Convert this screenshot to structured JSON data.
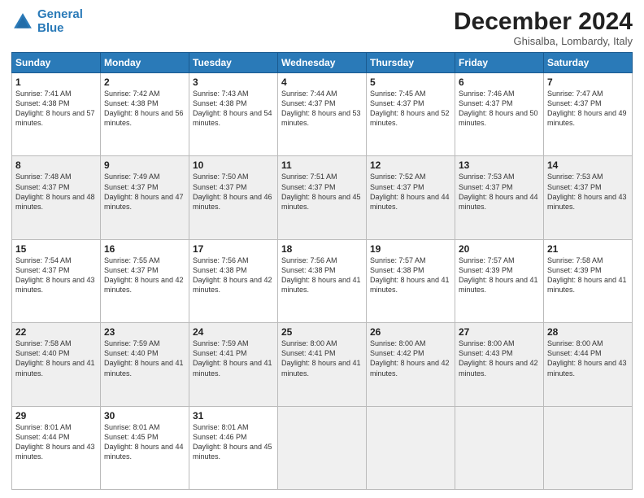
{
  "header": {
    "logo_line1": "General",
    "logo_line2": "Blue",
    "month_title": "December 2024",
    "subtitle": "Ghisalba, Lombardy, Italy"
  },
  "weekdays": [
    "Sunday",
    "Monday",
    "Tuesday",
    "Wednesday",
    "Thursday",
    "Friday",
    "Saturday"
  ],
  "weeks": [
    [
      {
        "day": "1",
        "sunrise": "Sunrise: 7:41 AM",
        "sunset": "Sunset: 4:38 PM",
        "daylight": "Daylight: 8 hours and 57 minutes."
      },
      {
        "day": "2",
        "sunrise": "Sunrise: 7:42 AM",
        "sunset": "Sunset: 4:38 PM",
        "daylight": "Daylight: 8 hours and 56 minutes."
      },
      {
        "day": "3",
        "sunrise": "Sunrise: 7:43 AM",
        "sunset": "Sunset: 4:38 PM",
        "daylight": "Daylight: 8 hours and 54 minutes."
      },
      {
        "day": "4",
        "sunrise": "Sunrise: 7:44 AM",
        "sunset": "Sunset: 4:37 PM",
        "daylight": "Daylight: 8 hours and 53 minutes."
      },
      {
        "day": "5",
        "sunrise": "Sunrise: 7:45 AM",
        "sunset": "Sunset: 4:37 PM",
        "daylight": "Daylight: 8 hours and 52 minutes."
      },
      {
        "day": "6",
        "sunrise": "Sunrise: 7:46 AM",
        "sunset": "Sunset: 4:37 PM",
        "daylight": "Daylight: 8 hours and 50 minutes."
      },
      {
        "day": "7",
        "sunrise": "Sunrise: 7:47 AM",
        "sunset": "Sunset: 4:37 PM",
        "daylight": "Daylight: 8 hours and 49 minutes."
      }
    ],
    [
      {
        "day": "8",
        "sunrise": "Sunrise: 7:48 AM",
        "sunset": "Sunset: 4:37 PM",
        "daylight": "Daylight: 8 hours and 48 minutes."
      },
      {
        "day": "9",
        "sunrise": "Sunrise: 7:49 AM",
        "sunset": "Sunset: 4:37 PM",
        "daylight": "Daylight: 8 hours and 47 minutes."
      },
      {
        "day": "10",
        "sunrise": "Sunrise: 7:50 AM",
        "sunset": "Sunset: 4:37 PM",
        "daylight": "Daylight: 8 hours and 46 minutes."
      },
      {
        "day": "11",
        "sunrise": "Sunrise: 7:51 AM",
        "sunset": "Sunset: 4:37 PM",
        "daylight": "Daylight: 8 hours and 45 minutes."
      },
      {
        "day": "12",
        "sunrise": "Sunrise: 7:52 AM",
        "sunset": "Sunset: 4:37 PM",
        "daylight": "Daylight: 8 hours and 44 minutes."
      },
      {
        "day": "13",
        "sunrise": "Sunrise: 7:53 AM",
        "sunset": "Sunset: 4:37 PM",
        "daylight": "Daylight: 8 hours and 44 minutes."
      },
      {
        "day": "14",
        "sunrise": "Sunrise: 7:53 AM",
        "sunset": "Sunset: 4:37 PM",
        "daylight": "Daylight: 8 hours and 43 minutes."
      }
    ],
    [
      {
        "day": "15",
        "sunrise": "Sunrise: 7:54 AM",
        "sunset": "Sunset: 4:37 PM",
        "daylight": "Daylight: 8 hours and 43 minutes."
      },
      {
        "day": "16",
        "sunrise": "Sunrise: 7:55 AM",
        "sunset": "Sunset: 4:37 PM",
        "daylight": "Daylight: 8 hours and 42 minutes."
      },
      {
        "day": "17",
        "sunrise": "Sunrise: 7:56 AM",
        "sunset": "Sunset: 4:38 PM",
        "daylight": "Daylight: 8 hours and 42 minutes."
      },
      {
        "day": "18",
        "sunrise": "Sunrise: 7:56 AM",
        "sunset": "Sunset: 4:38 PM",
        "daylight": "Daylight: 8 hours and 41 minutes."
      },
      {
        "day": "19",
        "sunrise": "Sunrise: 7:57 AM",
        "sunset": "Sunset: 4:38 PM",
        "daylight": "Daylight: 8 hours and 41 minutes."
      },
      {
        "day": "20",
        "sunrise": "Sunrise: 7:57 AM",
        "sunset": "Sunset: 4:39 PM",
        "daylight": "Daylight: 8 hours and 41 minutes."
      },
      {
        "day": "21",
        "sunrise": "Sunrise: 7:58 AM",
        "sunset": "Sunset: 4:39 PM",
        "daylight": "Daylight: 8 hours and 41 minutes."
      }
    ],
    [
      {
        "day": "22",
        "sunrise": "Sunrise: 7:58 AM",
        "sunset": "Sunset: 4:40 PM",
        "daylight": "Daylight: 8 hours and 41 minutes."
      },
      {
        "day": "23",
        "sunrise": "Sunrise: 7:59 AM",
        "sunset": "Sunset: 4:40 PM",
        "daylight": "Daylight: 8 hours and 41 minutes."
      },
      {
        "day": "24",
        "sunrise": "Sunrise: 7:59 AM",
        "sunset": "Sunset: 4:41 PM",
        "daylight": "Daylight: 8 hours and 41 minutes."
      },
      {
        "day": "25",
        "sunrise": "Sunrise: 8:00 AM",
        "sunset": "Sunset: 4:41 PM",
        "daylight": "Daylight: 8 hours and 41 minutes."
      },
      {
        "day": "26",
        "sunrise": "Sunrise: 8:00 AM",
        "sunset": "Sunset: 4:42 PM",
        "daylight": "Daylight: 8 hours and 42 minutes."
      },
      {
        "day": "27",
        "sunrise": "Sunrise: 8:00 AM",
        "sunset": "Sunset: 4:43 PM",
        "daylight": "Daylight: 8 hours and 42 minutes."
      },
      {
        "day": "28",
        "sunrise": "Sunrise: 8:00 AM",
        "sunset": "Sunset: 4:44 PM",
        "daylight": "Daylight: 8 hours and 43 minutes."
      }
    ],
    [
      {
        "day": "29",
        "sunrise": "Sunrise: 8:01 AM",
        "sunset": "Sunset: 4:44 PM",
        "daylight": "Daylight: 8 hours and 43 minutes."
      },
      {
        "day": "30",
        "sunrise": "Sunrise: 8:01 AM",
        "sunset": "Sunset: 4:45 PM",
        "daylight": "Daylight: 8 hours and 44 minutes."
      },
      {
        "day": "31",
        "sunrise": "Sunrise: 8:01 AM",
        "sunset": "Sunset: 4:46 PM",
        "daylight": "Daylight: 8 hours and 45 minutes."
      },
      null,
      null,
      null,
      null
    ]
  ]
}
